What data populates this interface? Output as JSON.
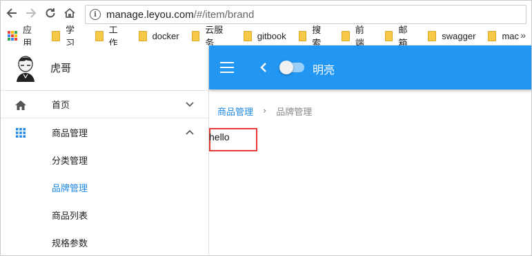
{
  "browser": {
    "url_host": "manage.leyou.com",
    "url_path": "/#/item/brand",
    "bookmarks": [
      {
        "label": "应用",
        "type": "apps"
      },
      {
        "label": "学习",
        "type": "folder"
      },
      {
        "label": "工作",
        "type": "folder"
      },
      {
        "label": "docker",
        "type": "folder"
      },
      {
        "label": "云服务",
        "type": "folder"
      },
      {
        "label": "gitbook",
        "type": "folder"
      },
      {
        "label": "搜索",
        "type": "folder"
      },
      {
        "label": "前端",
        "type": "folder"
      },
      {
        "label": "邮箱",
        "type": "folder"
      },
      {
        "label": "swagger",
        "type": "folder"
      },
      {
        "label": "mac",
        "type": "folder"
      }
    ],
    "more_symbol": "»"
  },
  "sidebar": {
    "user_name": "虎哥",
    "menu": [
      {
        "label": "首页",
        "icon": "home-icon",
        "expanded": false
      },
      {
        "label": "商品管理",
        "icon": "apps-icon",
        "expanded": true,
        "children": [
          {
            "label": "分类管理",
            "active": false
          },
          {
            "label": "品牌管理",
            "active": true
          },
          {
            "label": "商品列表",
            "active": false
          },
          {
            "label": "规格参数",
            "active": false
          }
        ]
      }
    ]
  },
  "header": {
    "switch_label": "明亮",
    "color": "#2196f3"
  },
  "breadcrumb": {
    "parent": "商品管理",
    "separator": "›",
    "current": "品牌管理"
  },
  "main": {
    "text": "hello",
    "highlight_color": "#e53935"
  }
}
